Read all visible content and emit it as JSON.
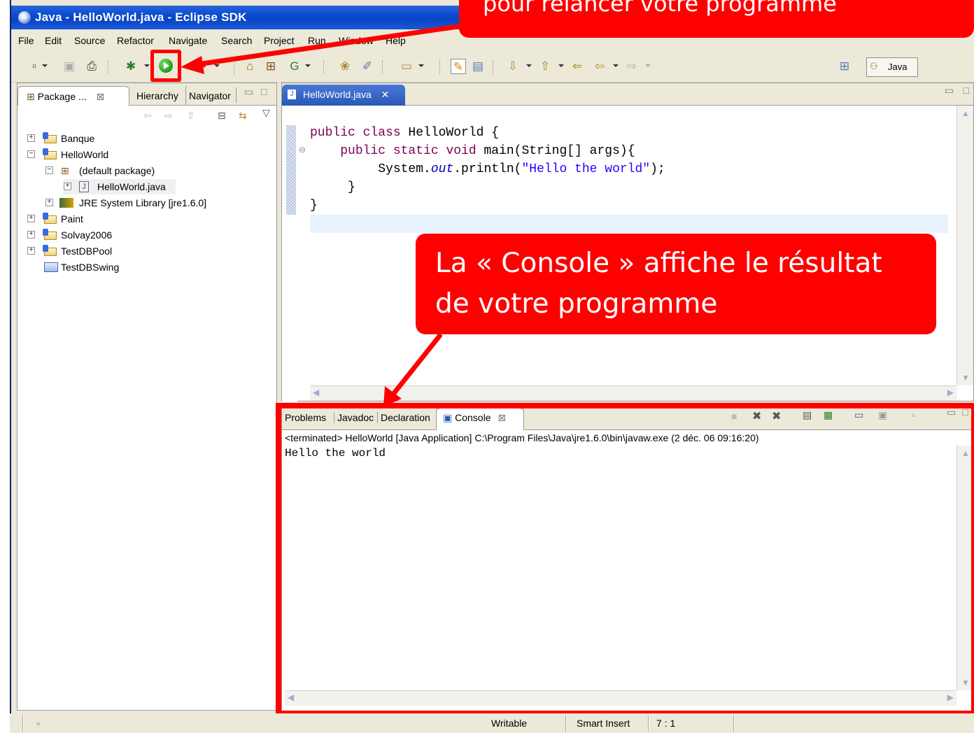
{
  "window": {
    "title": "Java - HelloWorld.java - Eclipse SDK"
  },
  "menu": [
    "File",
    "Edit",
    "Source",
    "Refactor",
    "Navigate",
    "Search",
    "Project",
    "Run",
    "Window",
    "Help"
  ],
  "perspective": {
    "label": "Java"
  },
  "package_explorer": {
    "tabs": [
      "Package ...",
      "Hierarchy",
      "Navigator"
    ],
    "tree": [
      {
        "label": "Banque",
        "kind": "project"
      },
      {
        "label": "HelloWorld",
        "kind": "project"
      },
      {
        "label": "(default package)",
        "kind": "package"
      },
      {
        "label": "HelloWorld.java",
        "kind": "java-file"
      },
      {
        "label": "JRE System Library [jre1.6.0]",
        "kind": "library"
      },
      {
        "label": "Paint",
        "kind": "project"
      },
      {
        "label": "Solvay2006",
        "kind": "project"
      },
      {
        "label": "TestDBPool",
        "kind": "project"
      },
      {
        "label": "TestDBSwing",
        "kind": "folder"
      }
    ]
  },
  "editor": {
    "tab_label": "HelloWorld.java",
    "code": {
      "l1_kw": "public class",
      "l1_rest": " HelloWorld {",
      "l2_kw": "public static void",
      "l2_rest": " main(String[] args){",
      "l3_a": "System.",
      "l3_out": "out",
      "l3_b": ".println(",
      "l3_str": "\"Hello the world\"",
      "l3_c": ");",
      "l4": "}",
      "l5": "}"
    }
  },
  "console": {
    "tabs": [
      "Problems",
      "Javadoc",
      "Declaration",
      "Console"
    ],
    "info": "<terminated> HelloWorld [Java Application] C:\\Program Files\\Java\\jre1.6.0\\bin\\javaw.exe (2 déc. 06 09:16:20)",
    "output": "Hello the world"
  },
  "status": {
    "writable": "Writable",
    "insert_mode": "Smart Insert",
    "position": "7 : 1"
  },
  "callouts": {
    "top": "pour relancer votre programme",
    "mid_line1": "La « Console » affiche le résultat",
    "mid_line2": "de votre programme"
  },
  "colors": {
    "annotation": "#ff0000",
    "titlebar": "#0a4bd0",
    "keyword": "#7f0055",
    "string": "#2a00ff"
  }
}
